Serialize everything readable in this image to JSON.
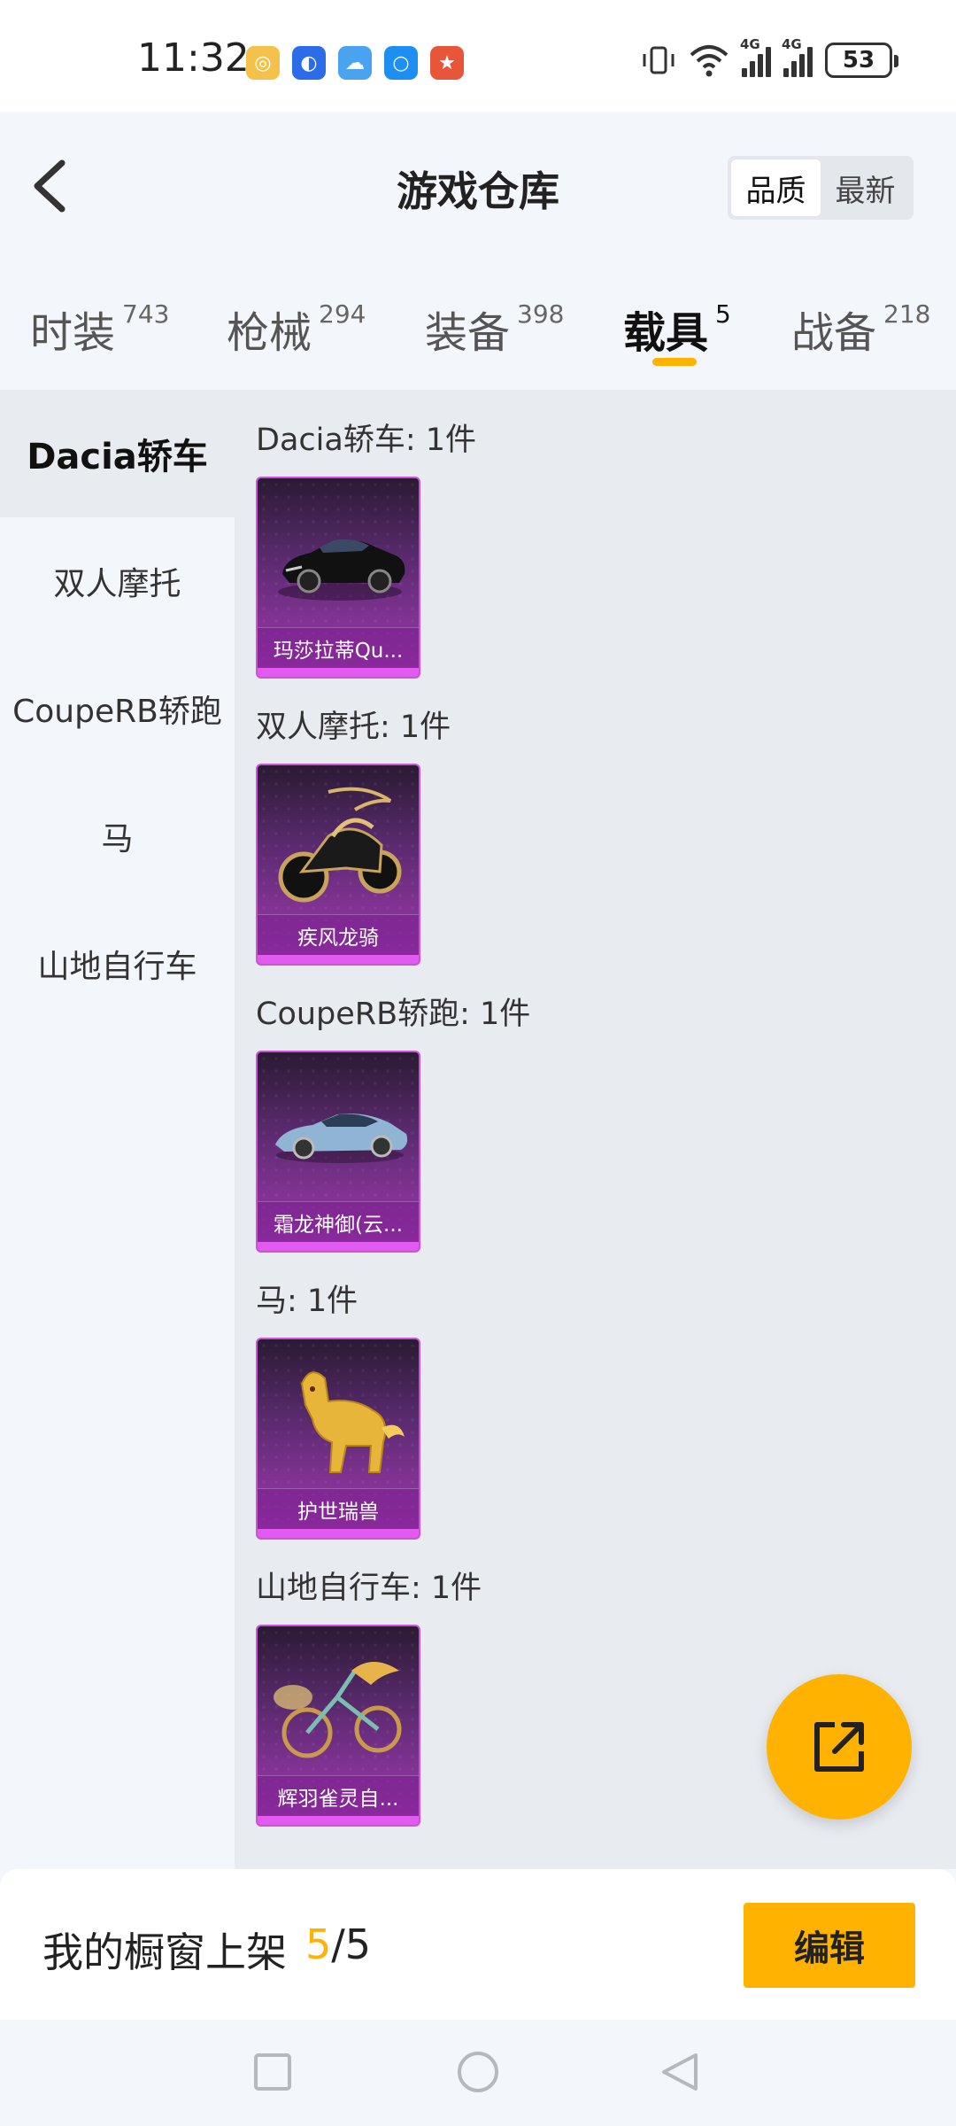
{
  "status_bar": {
    "time": "11:32",
    "battery": "53",
    "net_label_1": "4G",
    "net_label_2": "4G"
  },
  "header": {
    "title": "游戏仓库",
    "sort_options": [
      "品质",
      "最新"
    ],
    "active_sort": "品质"
  },
  "tabs": [
    {
      "label": "时装",
      "count": "743"
    },
    {
      "label": "枪械",
      "count": "294"
    },
    {
      "label": "装备",
      "count": "398"
    },
    {
      "label": "载具",
      "count": "5"
    },
    {
      "label": "战备",
      "count": "218"
    }
  ],
  "active_tab": "载具",
  "sidebar": {
    "items": [
      {
        "label": "Dacia轿车"
      },
      {
        "label": "双人摩托"
      },
      {
        "label": "CoupeRB轿跑"
      },
      {
        "label": "马"
      },
      {
        "label": "山地自行车"
      }
    ]
  },
  "groups": [
    {
      "title": "Dacia轿车: 1件",
      "item_name": "玛莎拉蒂Qu...",
      "icon": "sports-car-black-icon"
    },
    {
      "title": "双人摩托: 1件",
      "item_name": "疾风龙骑",
      "icon": "dragon-motorcycle-icon"
    },
    {
      "title": "CoupeRB轿跑: 1件",
      "item_name": "霜龙神御(云...",
      "icon": "blue-supercar-icon"
    },
    {
      "title": "马: 1件",
      "item_name": "护世瑞兽",
      "icon": "golden-qilin-icon"
    },
    {
      "title": "山地自行车: 1件",
      "item_name": "辉羽雀灵自...",
      "icon": "phoenix-bicycle-icon"
    }
  ],
  "bottom_bar": {
    "label": "我的橱窗上架",
    "count_current": "5",
    "count_separator": "/",
    "count_total": "5",
    "edit_label": "编辑"
  },
  "colors": {
    "accent": "#ffb300",
    "card_purple": "#a43ab5",
    "background": "#f3f6fa"
  }
}
